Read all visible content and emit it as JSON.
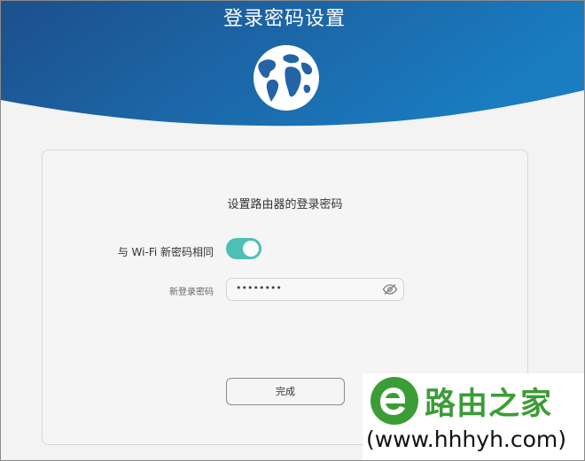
{
  "header": {
    "title": "登录密码设置",
    "gradient_start": "#1d4f8c",
    "gradient_end": "#1a7cc1",
    "icon": "globe-icon"
  },
  "card": {
    "title": "设置路由器的登录密码",
    "same_as_wifi": {
      "label": "与 Wi-Fi 新密码相同",
      "enabled": true,
      "on_color": "#4dbfb6"
    },
    "password": {
      "label": "新登录密码",
      "value": "••••••••",
      "icon": "eye-hidden-icon"
    },
    "done_label": "完成"
  },
  "watermark": {
    "brand": "路由之家",
    "url": "(www.hhhyh.com)",
    "brand_color": "#3b9d35",
    "icon": "letter-e-logo"
  }
}
